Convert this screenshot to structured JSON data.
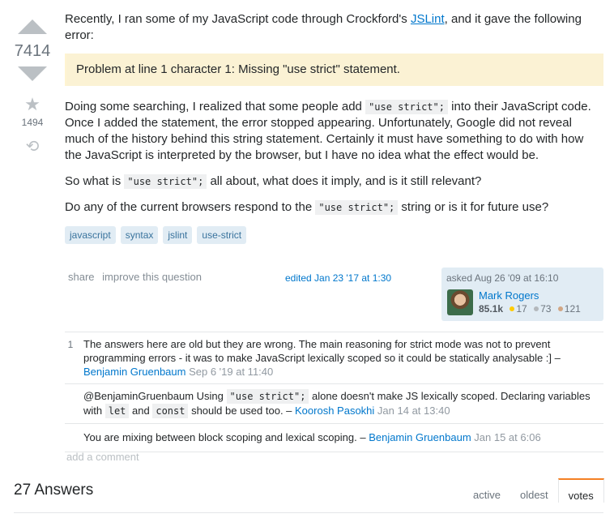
{
  "question": {
    "votes": "7414",
    "favorites": "1494",
    "intro_text": "Recently, I ran some of my JavaScript code through Crockford's ",
    "intro_link": "JSLint",
    "intro_text_after": ", and it gave the following error:",
    "error_note": "Problem at line 1 character 1: Missing \"use strict\" statement.",
    "p2_a": "Doing some searching, I realized that some people add ",
    "p2_code": "\"use strict\";",
    "p2_b": " into their JavaScript code. Once I added the statement, the error stopped appearing. Unfortunately, Google did not reveal much of the history behind this string statement. Certainly it must have something to do with how the JavaScript is interpreted by the browser, but I have no idea what the effect would be.",
    "p3_a": "So what is ",
    "p3_code": "\"use strict\";",
    "p3_b": " all about, what does it imply, and is it still relevant?",
    "p4_a": "Do any of the current browsers respond to the ",
    "p4_code": "\"use strict\";",
    "p4_b": " string or is it for future use?",
    "tags": [
      "javascript",
      "syntax",
      "jslint",
      "use-strict"
    ]
  },
  "menu": {
    "share": "share",
    "improve": "improve this question",
    "edited": "edited Jan 23 '17 at 1:30"
  },
  "owner": {
    "asked": "asked Aug 26 '09 at 16:10",
    "name": "Mark Rogers",
    "reputation": "85.1k",
    "gold": "17",
    "silver": "73",
    "bronze": "121",
    "colors": {
      "gold": "#ffcc01",
      "silver": "#b4b8bc",
      "bronze": "#d1a684"
    }
  },
  "comments": [
    {
      "score": "1",
      "text": "The answers here are old but they are wrong. The main reasoning for strict mode was not to prevent programming errors - it was to make JavaScript lexically scoped so it could be statically analysable :] – ",
      "user": "Benjamin Gruenbaum",
      "date": "Sep 6 '19 at 11:40"
    },
    {
      "score": "",
      "text_a": "@BenjaminGruenbaum Using ",
      "code1": "\"use strict\";",
      "text_b": " alone doesn't make JS lexically scoped. Declaring variables with ",
      "code2": "let",
      "text_c": " and ",
      "code3": "const",
      "text_d": " should be used too. – ",
      "user": "Koorosh Pasokhi",
      "date": "Jan 14 at 13:40"
    },
    {
      "score": "",
      "text": "You are mixing between block scoping and lexical scoping. – ",
      "user": "Benjamin Gruenbaum",
      "date": "Jan 15 at 6:06"
    }
  ],
  "add_comment": "add a comment",
  "answers": {
    "heading": "27 Answers",
    "tabs": [
      "active",
      "oldest",
      "votes"
    ]
  }
}
